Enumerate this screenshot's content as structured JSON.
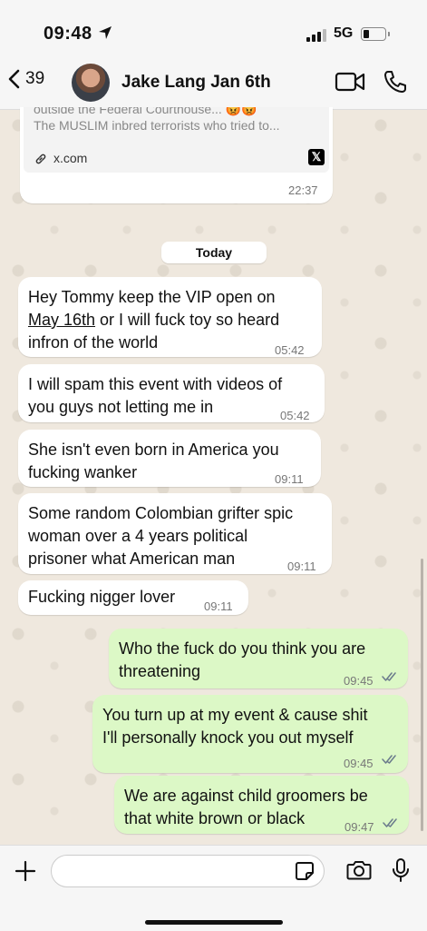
{
  "status_bar": {
    "time": "09:48",
    "network": "5G"
  },
  "header": {
    "back_count": "39",
    "contact_name": "Jake Lang Jan 6th"
  },
  "link_preview": {
    "title_partial": "outside the Federal Courthouse... 😡😡",
    "description": "The MUSLIM inbred terrorists who tried to...",
    "domain": "x.com",
    "time": "22:37",
    "logo_text": "𝕏"
  },
  "date_divider": "Today",
  "messages": [
    {
      "lines": [
        "Hey Tommy keep the VIP open on",
        "May 16th",
        " or I will fuck toy so heard",
        "infron of the world"
      ],
      "time": "05:42"
    },
    {
      "lines": [
        "I will spam this event with videos of",
        "you guys not letting me in"
      ],
      "time": "05:42"
    },
    {
      "lines": [
        "She isn't even born in America you",
        "fucking wanker"
      ],
      "time": "09:11"
    },
    {
      "lines": [
        "Some random Colombian grifter spic",
        "woman over a 4 years political",
        "prisoner what American man"
      ],
      "time": "09:11"
    },
    {
      "lines": [
        "Fucking nigger lover"
      ],
      "time": "09:11"
    },
    {
      "lines": [
        "Who the fuck do you think you are",
        "threatening"
      ],
      "time": "09:45"
    },
    {
      "lines": [
        "You turn up at my event & cause shit",
        "I'll personally knock you out myself"
      ],
      "time": "09:45"
    },
    {
      "lines": [
        "We are against child groomers be",
        "that white brown or black"
      ],
      "time": "09:47"
    }
  ],
  "composer": {
    "placeholder": ""
  },
  "colors": {
    "outgoing_bubble": "#dcf8c6",
    "incoming_bubble": "#ffffff",
    "read_ticks": "#6b7b8c"
  }
}
